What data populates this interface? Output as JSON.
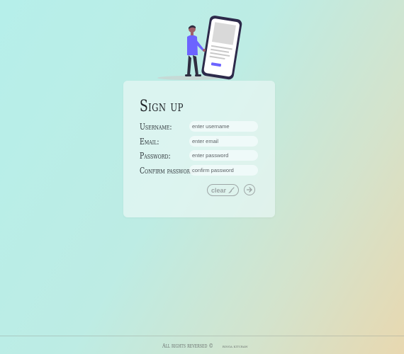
{
  "form": {
    "title": "Sign up",
    "fields": [
      {
        "label": "Username:",
        "placeholder": "enter username",
        "value": ""
      },
      {
        "label": "Email:",
        "placeholder": "enter email",
        "value": ""
      },
      {
        "label": "Password:",
        "placeholder": "enter password",
        "value": ""
      },
      {
        "label": "Confirm password:",
        "placeholder": "confirm password",
        "value": ""
      }
    ],
    "clear_label": "clear",
    "clear_icon": "broom-icon",
    "submit_icon": "arrow-right-circle-icon"
  },
  "footer": {
    "rights": "All rights reversed ©",
    "author": "ringa kitcraw"
  },
  "illustration": {
    "name": "person-with-phone-illustration",
    "accent": "#6c63ff"
  },
  "colors": {
    "background_start": "#b6efea",
    "background_end": "#e8d8b0",
    "card": "#e8f7f4",
    "button_border": "#9ea6a6"
  }
}
